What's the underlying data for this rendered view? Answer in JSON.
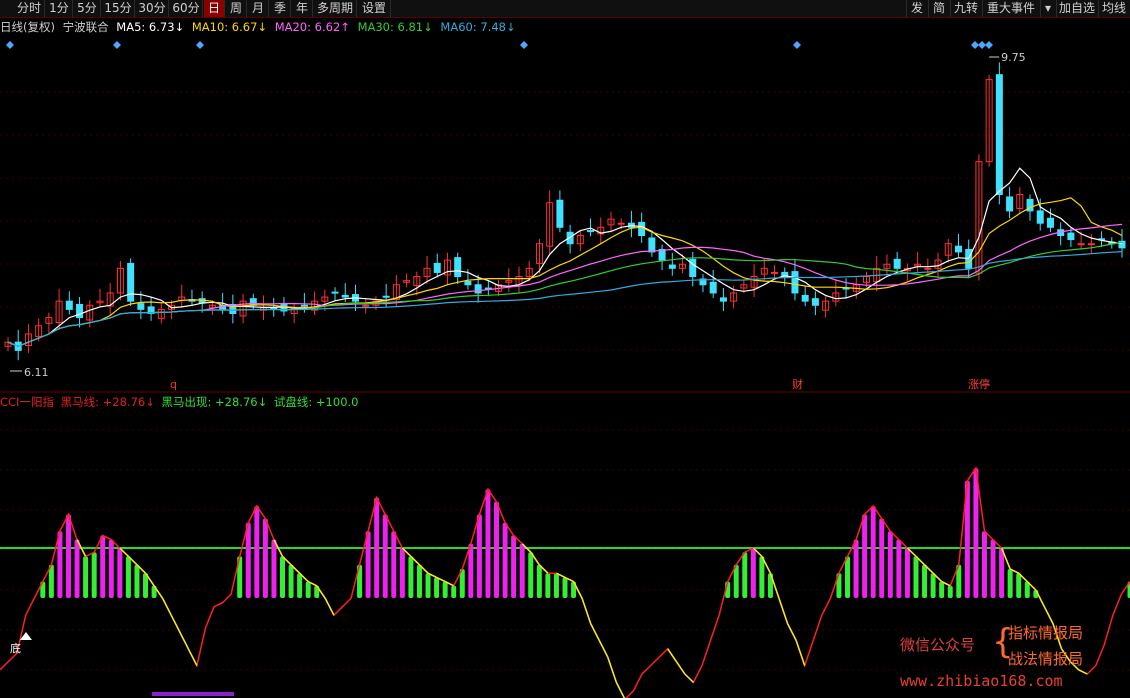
{
  "toolbar": {
    "tabs": [
      "分时",
      "1分",
      "5分",
      "15分",
      "30分",
      "60分",
      "日",
      "周",
      "月",
      "季",
      "年",
      "多周期",
      "设置"
    ],
    "active": "日",
    "right_buttons": [
      "发",
      "简",
      "九转",
      "重大事件",
      "▾",
      "加自选",
      "均线"
    ]
  },
  "main_info": {
    "period": "日线(复权)",
    "name": "宁波联合",
    "ma5": "MA5: 6.73↓",
    "ma10": "MA10: 6.67↓",
    "ma20": "MA20: 6.62↑",
    "ma30": "MA30: 6.81↓",
    "ma60": "MA60: 7.48↓",
    "colors": {
      "ma5": "#ffffff",
      "ma10": "#ffd700",
      "ma20": "#ff66ff",
      "ma30": "#33cc33",
      "ma60": "#33aadd"
    }
  },
  "chart_data": {
    "type": "candlestick",
    "high_label": "9.75",
    "low_label": "6.11",
    "markers": [
      "q",
      "财",
      "涨停"
    ],
    "closes": [
      6.4,
      6.3,
      6.5,
      6.6,
      6.7,
      6.9,
      6.8,
      6.7,
      6.85,
      6.9,
      7.0,
      7.3,
      6.9,
      6.8,
      6.75,
      6.8,
      6.85,
      6.95,
      6.9,
      6.88,
      6.85,
      6.8,
      6.75,
      6.9,
      6.85,
      6.82,
      6.8,
      6.78,
      6.82,
      6.85,
      6.9,
      6.95,
      7.0,
      6.95,
      6.9,
      6.85,
      6.9,
      6.95,
      7.1,
      7.15,
      7.2,
      7.3,
      7.25,
      7.4,
      7.2,
      7.1,
      7.0,
      7.05,
      7.1,
      7.15,
      7.2,
      7.3,
      7.6,
      8.1,
      7.8,
      7.6,
      7.7,
      7.75,
      7.8,
      7.9,
      7.85,
      7.8,
      7.7,
      7.5,
      7.4,
      7.3,
      7.35,
      7.2,
      7.1,
      7.0,
      6.9,
      7.0,
      7.1,
      7.2,
      7.3,
      7.25,
      7.2,
      7.0,
      6.9,
      6.85,
      6.9,
      7.0,
      7.05,
      7.1,
      7.2,
      7.3,
      7.35,
      7.3,
      7.3,
      7.35,
      7.3,
      7.4,
      7.6,
      7.5,
      7.3,
      8.6,
      9.6,
      8.2,
      8.0,
      8.2,
      8.0,
      7.85,
      7.8,
      7.7,
      7.65,
      7.6,
      7.6,
      7.65,
      7.6,
      7.55
    ],
    "cci": {
      "labels": [
        "CCI一阳指",
        "黑马线: +28.76↓",
        "黑马出现: +28.76↓",
        "试盘线: +100.0"
      ],
      "threshold": 100,
      "values": [
        -190,
        -170,
        -150,
        -60,
        -20,
        20,
        60,
        140,
        180,
        120,
        80,
        90,
        130,
        120,
        100,
        80,
        60,
        40,
        10,
        -20,
        -60,
        -100,
        -140,
        -180,
        -90,
        -40,
        -30,
        -10,
        80,
        160,
        200,
        170,
        120,
        80,
        60,
        40,
        20,
        10,
        -20,
        -60,
        -40,
        -20,
        60,
        140,
        220,
        180,
        140,
        100,
        80,
        60,
        40,
        30,
        20,
        10,
        50,
        110,
        180,
        240,
        210,
        160,
        130,
        110,
        90,
        60,
        40,
        40,
        30,
        20,
        -20,
        -80,
        -120,
        -160,
        -220,
        -260,
        -240,
        -200,
        -180,
        -160,
        -140,
        -170,
        -200,
        -220,
        -180,
        -120,
        -60,
        20,
        60,
        90,
        100,
        80,
        40,
        -20,
        -80,
        -120,
        -180,
        -120,
        -60,
        -20,
        40,
        80,
        120,
        180,
        200,
        170,
        140,
        120,
        100,
        80,
        60,
        40,
        20,
        10,
        60,
        260,
        290,
        140,
        120,
        100,
        50,
        40,
        20,
        0,
        -40,
        -80,
        -140,
        -170,
        -190,
        -200,
        -180,
        -130,
        -60,
        -10,
        20
      ]
    }
  },
  "watermark": {
    "line1": "微信公众号",
    "line2": "指标情报局",
    "line3": "战法情报局",
    "url": "www.zhibiao168.com"
  }
}
